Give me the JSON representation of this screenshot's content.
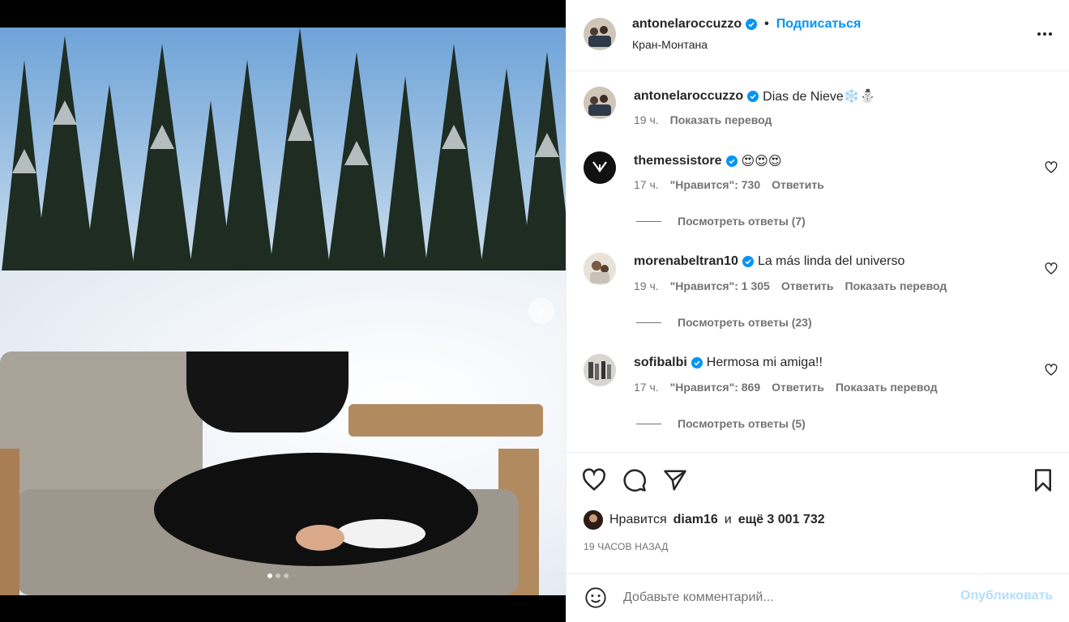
{
  "post": {
    "author": "antonelaroccuzzo",
    "follow_label": "Подписаться",
    "separator": "•",
    "location": "Кран-Монтана",
    "more_icon": "more-horizontal-icon"
  },
  "caption": {
    "user": "antonelaroccuzzo",
    "text": "Dias de Nieve❄️⛄",
    "time": "19 ч.",
    "translate": "Показать перевод"
  },
  "comments": [
    {
      "user": "themessistore",
      "text": "😍😍😍",
      "time": "17 ч.",
      "likes": "\"Нравится\": 730",
      "reply": "Ответить",
      "translate": "",
      "view_replies": "Посмотреть ответы (7)"
    },
    {
      "user": "morenabeltran10",
      "text": "La más linda del universo",
      "time": "19 ч.",
      "likes": "\"Нравится\": 1 305",
      "reply": "Ответить",
      "translate": "Показать перевод",
      "view_replies": "Посмотреть ответы (23)"
    },
    {
      "user": "sofibalbi",
      "text": "Hermosa mi amiga!!",
      "time": "17 ч.",
      "likes": "\"Нравится\": 869",
      "reply": "Ответить",
      "translate": "Показать перевод",
      "view_replies": "Посмотреть ответы (5)"
    }
  ],
  "likes": {
    "prefix": "Нравится",
    "user": "diam16",
    "and": "и",
    "more": "ещё 3 001 732"
  },
  "timestamp": "19 ЧАСОВ НАЗАД",
  "composer": {
    "placeholder": "Добавьте комментарий...",
    "publish": "Опубликовать"
  },
  "carousel": {
    "current": 1,
    "total": 3
  },
  "colors": {
    "accent": "#0095f6",
    "verified": "#0095f6",
    "muted": "#737373",
    "publish_disabled": "#b2dffc"
  }
}
